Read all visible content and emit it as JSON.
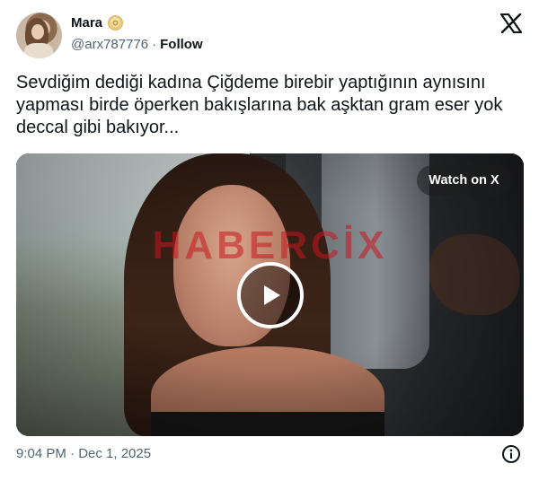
{
  "user": {
    "display_name": "Mara",
    "badge_icon": "emoji-badge-icon",
    "handle": "@arx787776",
    "separator": "·",
    "follow_label": "Follow"
  },
  "brand_icon": "x-logo-icon",
  "tweet": {
    "text": "Sevdiğim dediği kadına Çiğdeme birebir yaptığının aynısını yapması birde öperken bakışlarına bak aşktan gram eser yok deccal gibi bakıyor..."
  },
  "media": {
    "watermark": "HABERCİX",
    "watch_label": "Watch on X",
    "play_icon": "play-icon"
  },
  "footer": {
    "timestamp": "9:04 PM · Dec 1, 2025",
    "info_icon": "info-icon"
  },
  "colors": {
    "text_primary": "#0f1419",
    "text_secondary": "#536471",
    "watermark": "#c8141e",
    "background": "#ffffff"
  }
}
